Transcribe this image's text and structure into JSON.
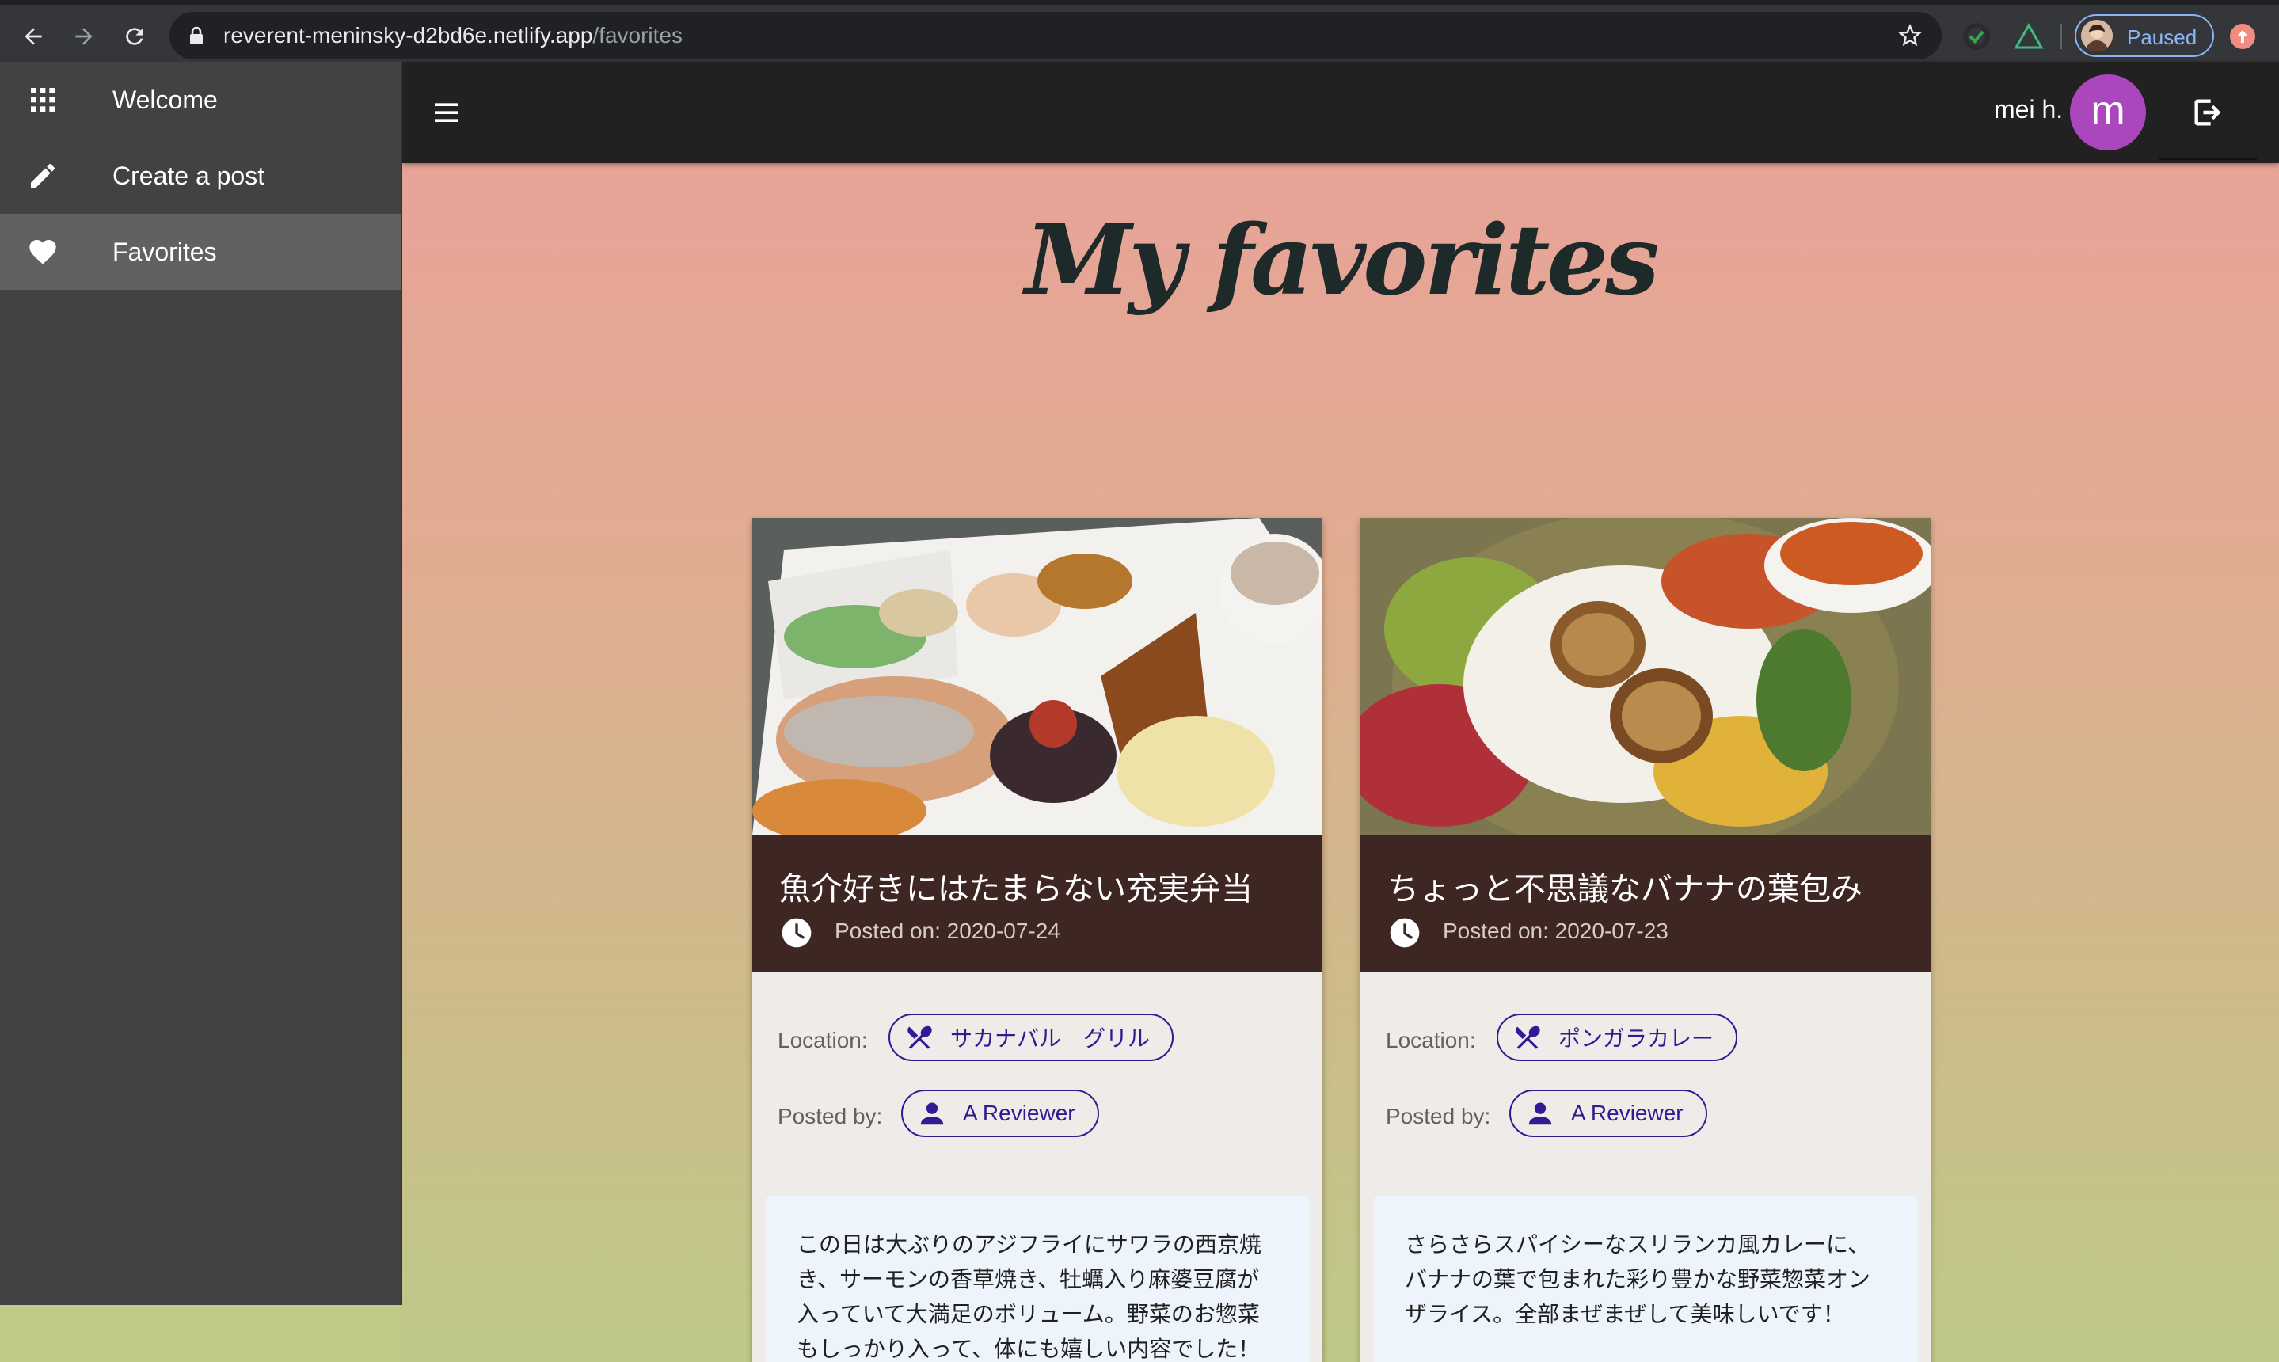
{
  "browser": {
    "url_host": "reverent-meninsky-d2bd6e.netlify.app",
    "url_path": "/favorites",
    "profile_status": "Paused"
  },
  "drawer": {
    "items": [
      {
        "label": "Welcome",
        "icon": "apps-grid-icon"
      },
      {
        "label": "Create a post",
        "icon": "pencil-icon"
      },
      {
        "label": "Favorites",
        "icon": "heart-icon",
        "active": true
      }
    ]
  },
  "topbar": {
    "user_name": "mei h.",
    "avatar_initial": "m",
    "avatar_color": "#ab47bc"
  },
  "page": {
    "title": "My favorites"
  },
  "cards": [
    {
      "title": "魚介好きにはたまらない充実弁当",
      "date": "Posted on: 2020-07-24",
      "location_label": "Location:",
      "location": "サカナバル　グリル",
      "posted_by_label": "Posted by:",
      "reviewer": "A Reviewer",
      "body": "この日は大ぶりのアジフライにサワラの西京焼き、サーモンの香草焼き、牡蠣入り麻婆豆腐が入っていて大満足のボリューム。野菜のお惣菜もしっかり入って、体にも嬉しい内容でした！"
    },
    {
      "title": "ちょっと不思議なバナナの葉包み",
      "date": "Posted on: 2020-07-23",
      "location_label": "Location:",
      "location": "ポンガラカレー",
      "posted_by_label": "Posted by:",
      "reviewer": "A Reviewer",
      "body": "さらさらスパイシーなスリランカ風カレーに、バナナの葉で包まれた彩り豊かな野菜惣菜オンザライス。全部まぜまぜして美味しいです！"
    }
  ],
  "colors": {
    "card_header": "#3e2723",
    "chip_accent": "#311b92",
    "drawer_bg": "#424242",
    "topbar_bg": "#212121"
  }
}
